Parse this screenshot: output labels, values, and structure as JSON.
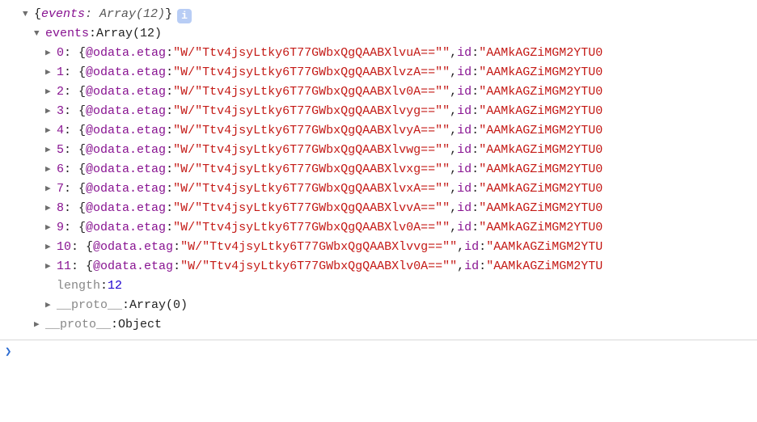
{
  "info_badge": "i",
  "root": {
    "summary_key": "events",
    "type_label": "Array",
    "count": 12
  },
  "events_line": {
    "key": "events",
    "type_label": "Array",
    "count": 12
  },
  "items": [
    {
      "idx": "0",
      "etag_key": "@odata.etag",
      "etag": "\"W/\"Ttv4jsyLtky6T77GWbxQgQAABXlvuA==\"\"",
      "idkey": "id",
      "id": "\"AAMkAGZiMGM2YTU0"
    },
    {
      "idx": "1",
      "etag_key": "@odata.etag",
      "etag": "\"W/\"Ttv4jsyLtky6T77GWbxQgQAABXlvzA==\"\"",
      "idkey": "id",
      "id": "\"AAMkAGZiMGM2YTU0"
    },
    {
      "idx": "2",
      "etag_key": "@odata.etag",
      "etag": "\"W/\"Ttv4jsyLtky6T77GWbxQgQAABXlv0A==\"\"",
      "idkey": "id",
      "id": "\"AAMkAGZiMGM2YTU0"
    },
    {
      "idx": "3",
      "etag_key": "@odata.etag",
      "etag": "\"W/\"Ttv4jsyLtky6T77GWbxQgQAABXlvyg==\"\"",
      "idkey": "id",
      "id": "\"AAMkAGZiMGM2YTU0"
    },
    {
      "idx": "4",
      "etag_key": "@odata.etag",
      "etag": "\"W/\"Ttv4jsyLtky6T77GWbxQgQAABXlvyA==\"\"",
      "idkey": "id",
      "id": "\"AAMkAGZiMGM2YTU0"
    },
    {
      "idx": "5",
      "etag_key": "@odata.etag",
      "etag": "\"W/\"Ttv4jsyLtky6T77GWbxQgQAABXlvwg==\"\"",
      "idkey": "id",
      "id": "\"AAMkAGZiMGM2YTU0"
    },
    {
      "idx": "6",
      "etag_key": "@odata.etag",
      "etag": "\"W/\"Ttv4jsyLtky6T77GWbxQgQAABXlvxg==\"\"",
      "idkey": "id",
      "id": "\"AAMkAGZiMGM2YTU0"
    },
    {
      "idx": "7",
      "etag_key": "@odata.etag",
      "etag": "\"W/\"Ttv4jsyLtky6T77GWbxQgQAABXlvxA==\"\"",
      "idkey": "id",
      "id": "\"AAMkAGZiMGM2YTU0"
    },
    {
      "idx": "8",
      "etag_key": "@odata.etag",
      "etag": "\"W/\"Ttv4jsyLtky6T77GWbxQgQAABXlvvA==\"\"",
      "idkey": "id",
      "id": "\"AAMkAGZiMGM2YTU0"
    },
    {
      "idx": "9",
      "etag_key": "@odata.etag",
      "etag": "\"W/\"Ttv4jsyLtky6T77GWbxQgQAABXlv0A==\"\"",
      "idkey": "id",
      "id": "\"AAMkAGZiMGM2YTU0"
    },
    {
      "idx": "10",
      "etag_key": "@odata.etag",
      "etag": "\"W/\"Ttv4jsyLtky6T77GWbxQgQAABXlvvg==\"\"",
      "idkey": "id",
      "id": "\"AAMkAGZiMGM2YTU"
    },
    {
      "idx": "11",
      "etag_key": "@odata.etag",
      "etag": "\"W/\"Ttv4jsyLtky6T77GWbxQgQAABXlv0A==\"\"",
      "idkey": "id",
      "id": "\"AAMkAGZiMGM2YTU"
    }
  ],
  "length_line": {
    "key": "length",
    "value": 12
  },
  "proto_array": {
    "key": "__proto__",
    "label": "Array(0)"
  },
  "proto_object": {
    "key": "__proto__",
    "label": "Object"
  },
  "prompt": "❯"
}
